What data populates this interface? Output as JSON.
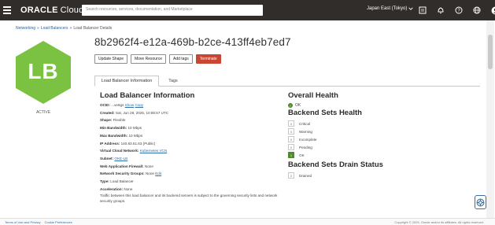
{
  "header": {
    "brand_bold": "ORACLE",
    "brand_light": "Cloud",
    "search_placeholder": "Search resources, services, documentation, and Marketplace",
    "region": "Japan East (Tokyo)",
    "icons": [
      "console-icon",
      "bell-icon",
      "help-icon",
      "globe-icon",
      "user-icon"
    ]
  },
  "breadcrumb": {
    "items": [
      "Networking",
      "Load Balancers",
      "Load Balancer Details"
    ],
    "separator": "»"
  },
  "badge": {
    "text": "LB",
    "status": "ACTIVE",
    "color": "#7bc142"
  },
  "title": "8b2962f4-e12a-469b-b2ce-413ff4eb7ed7",
  "buttons": {
    "update_shape": "Update Shape",
    "move_resource": "Move Resource",
    "add_tags": "Add tags",
    "terminate": "Terminate"
  },
  "tabs": [
    "Load Balancer Information",
    "Tags"
  ],
  "lb_info": {
    "heading": "Load Balancer Information",
    "ocid_label": "OCID:",
    "ocid_value": "...ve6gs",
    "ocid_show": "Show",
    "ocid_copy": "Copy",
    "created_label": "Created:",
    "created_value": "Sat, Jun 28, 2025, 10:56:57 UTC",
    "shape_label": "Shape:",
    "shape_value": "Flexible",
    "min_bw_label": "Min Bandwidth:",
    "min_bw_value": "10 Mbps",
    "max_bw_label": "Max Bandwidth:",
    "max_bw_value": "10 Mbps",
    "ip_label": "IP Address:",
    "ip_value": "140.83.51.63 (Public)",
    "vcn_label": "Virtual Cloud Network:",
    "vcn_value": "Kubernetes VCN",
    "subnet_label": "Subnet:",
    "subnet_value": "OKE-LB",
    "waf_label": "Web Application Firewall:",
    "waf_value": "None",
    "nsg_label": "Network Security Groups:",
    "nsg_value": "None",
    "nsg_edit": "Edit",
    "type_label": "Type:",
    "type_value": "Load Balancer",
    "accel_label": "Acceleration:",
    "accel_value": "None",
    "traffic_note": "Traffic between this load balancer and its backend servers is subject to the governing security lists and network security groups."
  },
  "overall": {
    "heading": "Overall Health",
    "status": "OK",
    "backend_heading": "Backend Sets Health",
    "backend_items": [
      {
        "count": "0",
        "label": "Critical"
      },
      {
        "count": "0",
        "label": "Warning"
      },
      {
        "count": "0",
        "label": "Incomplete"
      },
      {
        "count": "0",
        "label": "Pending"
      },
      {
        "count": "1",
        "label": "OK"
      }
    ],
    "drain_heading": "Backend Sets Drain Status",
    "drain_items": [
      {
        "count": "0",
        "label": "Drained"
      }
    ],
    "ok_color": "#4f8a2b"
  },
  "footer": {
    "terms": "Terms of Use and Privacy",
    "cookie": "Cookie Preferences",
    "copyright": "Copyright © 2025, Oracle and/or its affiliates. All rights reserved."
  }
}
